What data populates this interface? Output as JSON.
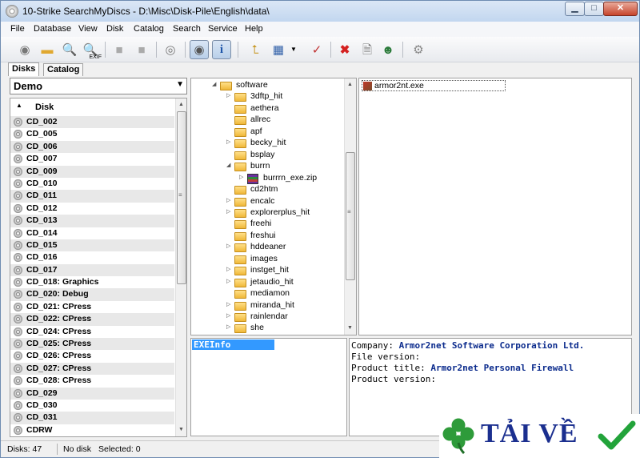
{
  "window": {
    "title": "10-Strike SearchMyDiscs - D:\\Misc\\Disk-Pile\\English\\data\\"
  },
  "menu": [
    "File",
    "Database",
    "View",
    "Disk",
    "Catalog",
    "Search",
    "Service",
    "Help"
  ],
  "toolbar": {
    "exif_label": "EXIF"
  },
  "left_tabs": [
    "Disks",
    "Catalog"
  ],
  "catalog_combo": {
    "value": "Demo"
  },
  "disk_list": {
    "column_header": "Disk",
    "items": [
      "CD_002",
      "CD_005",
      "CD_006",
      "CD_007",
      "CD_009",
      "CD_010",
      "CD_011",
      "CD_012",
      "CD_013",
      "CD_014",
      "CD_015",
      "CD_016",
      "CD_017",
      "CD_018: Graphics",
      "CD_020: Debug",
      "CD_021: CPress",
      "CD_022: CPress",
      "CD_024: CPress",
      "CD_025: CPress",
      "CD_026: CPress",
      "CD_027: CPress",
      "CD_028: CPress",
      "CD_029",
      "CD_030",
      "CD_031",
      "CDRW"
    ]
  },
  "folder_tree": {
    "root": "software",
    "items": [
      {
        "name": "3dftp_hit",
        "exp": "▷"
      },
      {
        "name": "aethera",
        "exp": ""
      },
      {
        "name": "allrec",
        "exp": ""
      },
      {
        "name": "apf",
        "exp": ""
      },
      {
        "name": "becky_hit",
        "exp": "▷"
      },
      {
        "name": "bsplay",
        "exp": ""
      },
      {
        "name": "burrn",
        "exp": "◢"
      },
      {
        "name": "burrrn_exe.zip",
        "exp": "▷",
        "child": true,
        "zip": true
      },
      {
        "name": "cd2htm",
        "exp": ""
      },
      {
        "name": "encalc",
        "exp": "▷"
      },
      {
        "name": "explorerplus_hit",
        "exp": "▷"
      },
      {
        "name": "freehi",
        "exp": ""
      },
      {
        "name": "freshui",
        "exp": ""
      },
      {
        "name": "hddeaner",
        "exp": "▷"
      },
      {
        "name": "images",
        "exp": ""
      },
      {
        "name": "instget_hit",
        "exp": "▷"
      },
      {
        "name": "jetaudio_hit",
        "exp": "▷"
      },
      {
        "name": "mediamon",
        "exp": ""
      },
      {
        "name": "miranda_hit",
        "exp": "▷"
      },
      {
        "name": "rainlendar",
        "exp": "▷"
      },
      {
        "name": "she",
        "exp": "▷"
      }
    ]
  },
  "files": {
    "selected": "armor2nt.exe"
  },
  "info": {
    "section": "EXEInfo",
    "company_label": "Company:",
    "company_value": "Armor2net Software Corporation Ltd.",
    "file_version_label": "File version:",
    "file_version_value": "",
    "product_title_label": "Product title:",
    "product_title_value": "Armor2net Personal Firewall",
    "product_version_label": "Product version:",
    "product_version_value": ""
  },
  "status": {
    "disks": "Disks: 47",
    "disk_state": "No disk",
    "selected": "Selected: 0"
  },
  "watermark": {
    "text": "TẢI VỀ"
  }
}
